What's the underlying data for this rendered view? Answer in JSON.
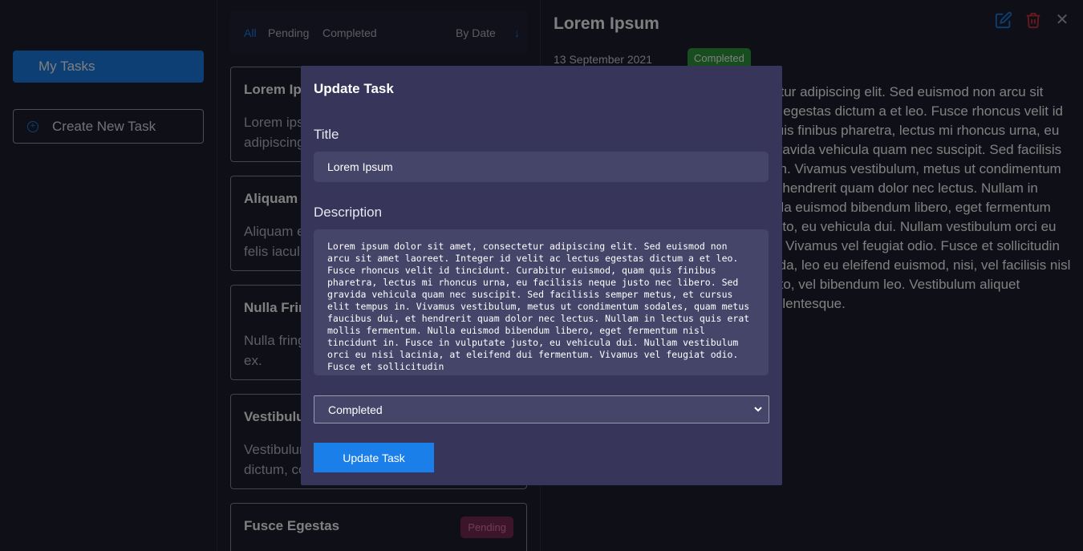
{
  "sidebar": {
    "my_tasks": "My Tasks",
    "create_new_task": "Create New Task"
  },
  "filters": {
    "all": "All",
    "pending": "Pending",
    "completed": "Completed",
    "by_date": "By Date"
  },
  "tasks": [
    {
      "title": "Lorem Ipsum",
      "desc": "Lorem ipsum dolor sit amet, consectetur adipiscing elit."
    },
    {
      "title": "Aliquam",
      "desc": "Aliquam erat volutpat. Integer sit amet at felis iaculis."
    },
    {
      "title": "Nulla Fringilla",
      "desc": "Nulla fringilla, tellus in pretium aliquet, ipsum ex."
    },
    {
      "title": "Vestibulum",
      "desc": "Vestibulum ante ipsum primis in faucibus dictum, commodo."
    },
    {
      "title": "Fusce Egestas",
      "status": "Pending"
    }
  ],
  "detail": {
    "title": "Lorem Ipsum",
    "date": "13 September 2021",
    "status": "Completed",
    "body": "Lorem ipsum dolor sit amet, consectetur adipiscing elit. Sed euismod non arcu sit amet laoreet. Integer id velit ac lectus egestas dictum a et leo. Fusce rhoncus velit id tincidunt. Curabitur euismod, quam quis finibus pharetra, lectus mi rhoncus urna, eu facilisis neque justo nec libero. Sed gravida vehicula quam nec suscipit. Sed facilisis semper metus, et cursus elit tempus in. Vivamus vestibulum, metus ut condimentum sodales, quam metus faucibus dui, et hendrerit quam dolor nec lectus. Nullam in lectus quis erat mollis fermentum. Nulla euismod bibendum libero, eget fermentum nisl tincidunt in. Fusce in vulputate justo, eu vehicula dui. Nullam vestibulum orci eu nisi lacinia, at eleifend dui fermentum. Vivamus vel feugiat odio. Fusce et sollicitudin mauris, et odio ante. Nullam malesuada, leo eu eleifend euismod, nisi, vel facilisis nisl nulla eu justo. Donec nec dapibus justo, vel bibendum leo. Vestibulum aliquet scelerisque nunc. Vestibulum eget pellentesque."
  },
  "modal": {
    "heading": "Update Task",
    "title_label": "Title",
    "title_value": "Lorem Ipsum",
    "description_label": "Description",
    "description_value": "Lorem ipsum dolor sit amet, consectetur adipiscing elit. Sed euismod non arcu sit amet laoreet. Integer id velit ac lectus egestas dictum a et leo. Fusce rhoncus velit id tincidunt. Curabitur euismod, quam quis finibus pharetra, lectus mi rhoncus urna, eu facilisis neque justo nec libero. Sed gravida vehicula quam nec suscipit. Sed facilisis semper metus, et cursus elit tempus in. Vivamus vestibulum, metus ut condimentum sodales, quam metus faucibus dui, et hendrerit quam dolor nec lectus. Nullam in lectus quis erat mollis fermentum. Nulla euismod bibendum libero, eget fermentum nisl tincidunt in. Fusce in vulputate justo, eu vehicula dui. Nullam vestibulum orci eu nisi lacinia, at eleifend dui fermentum. Vivamus vel feugiat odio. Fusce et sollicitudin",
    "status_selected": "Completed",
    "submit_label": "Update Task"
  },
  "colors": {
    "accent": "#1a7fe8",
    "completed": "#2e9a3e",
    "pending": "#7a2a55",
    "delete": "#d8353a",
    "modal_bg": "#37365a",
    "input_bg": "#454469"
  },
  "icons": {
    "plus": "plus-circle-icon",
    "sort": "arrow-down-icon",
    "edit": "edit-icon",
    "delete": "trash-icon",
    "close": "close-icon"
  }
}
